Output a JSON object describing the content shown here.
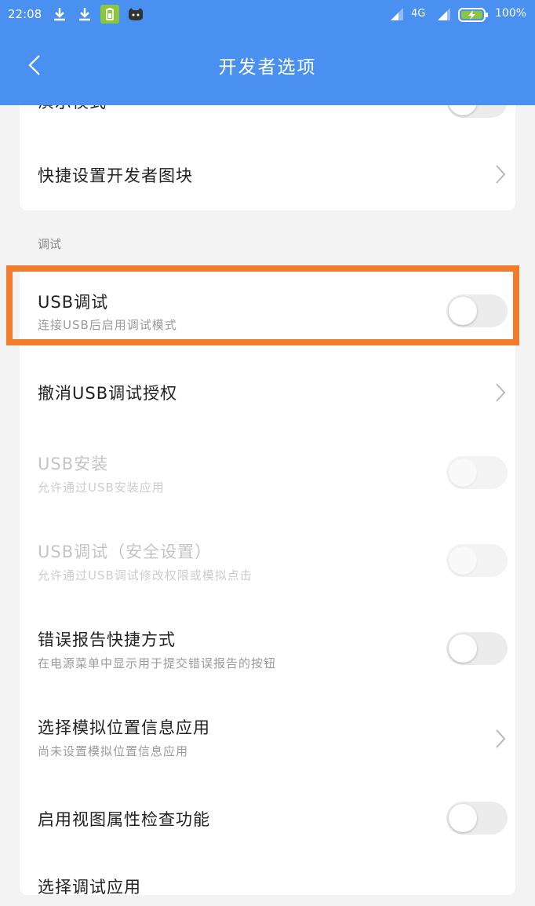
{
  "status_bar": {
    "time": "22:08",
    "network": "4G",
    "battery": "100%",
    "left_icons": [
      "download-icon",
      "download-icon",
      "battery-saver-app-icon",
      "cat-app-icon"
    ],
    "right_icons": [
      "signal-icon",
      "signal-icon",
      "battery-charging-icon"
    ]
  },
  "header": {
    "title": "开发者选项",
    "back_icon": "chevron-left-icon",
    "color": "#4a90f0"
  },
  "top_card": {
    "items": [
      {
        "title": "演示模式",
        "control": "toggle",
        "on": false
      },
      {
        "title": "快捷设置开发者图块",
        "control": "chevron"
      }
    ]
  },
  "debug_section": {
    "label": "调试",
    "items": [
      {
        "title": "USB调试",
        "subtitle": "连接USB后启用调试模式",
        "control": "toggle",
        "on": false,
        "highlighted": true
      },
      {
        "title": "撤消USB调试授权",
        "control": "chevron"
      },
      {
        "title": "USB安装",
        "subtitle": "允许通过USB安装应用",
        "control": "toggle",
        "on": false,
        "enabled": false
      },
      {
        "title": "USB调试（安全设置）",
        "subtitle": "允许通过USB调试修改权限或模拟点击",
        "control": "toggle",
        "on": false,
        "enabled": false
      },
      {
        "title": "错误报告快捷方式",
        "subtitle": "在电源菜单中显示用于提交错误报告的按钮",
        "control": "toggle",
        "on": false
      },
      {
        "title": "选择模拟位置信息应用",
        "subtitle": "尚未设置模拟位置信息应用",
        "control": "chevron"
      },
      {
        "title": "启用视图属性检查功能",
        "control": "toggle",
        "on": false
      },
      {
        "title": "选择调试应用",
        "control": "chevron"
      }
    ]
  },
  "highlight_color": "#f07c2c"
}
